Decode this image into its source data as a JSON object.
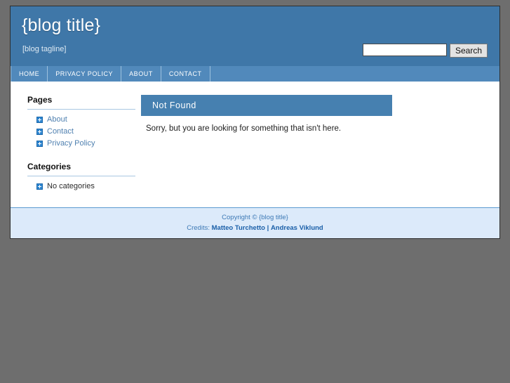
{
  "site": {
    "title": "{blog title}",
    "tagline": "[blog tagline]"
  },
  "search": {
    "value": "",
    "placeholder": "",
    "button_label": "Search"
  },
  "nav": {
    "items": [
      {
        "label": "HOME"
      },
      {
        "label": "PRIVACY POLICY"
      },
      {
        "label": "ABOUT"
      },
      {
        "label": "CONTACT"
      }
    ]
  },
  "sidebar": {
    "widgets": [
      {
        "title": "Pages",
        "items": [
          {
            "label": "About",
            "link": true
          },
          {
            "label": "Contact",
            "link": true
          },
          {
            "label": "Privacy Policy",
            "link": true
          }
        ]
      },
      {
        "title": "Categories",
        "items": [
          {
            "label": "No categories",
            "link": false
          }
        ]
      }
    ]
  },
  "main": {
    "post_title": "Not Found",
    "post_body": "Sorry, but you are looking for something that isn't here."
  },
  "footer": {
    "copyright": "Copyright © {blog title}",
    "credits_label": "Credits:",
    "credit_one": "Matteo Turchetto",
    "credit_separator": "|",
    "credit_two": "Andreas Viklund"
  },
  "icons": {
    "bullet": "bullet-square-icon"
  },
  "colors": {
    "header_blue": "#3f77a8",
    "nav_blue": "#5189bb",
    "title_bar_blue": "#4680b0",
    "footer_blue": "#dceafa",
    "link_blue": "#4f80b0",
    "page_bg": "#6e6e6e"
  }
}
